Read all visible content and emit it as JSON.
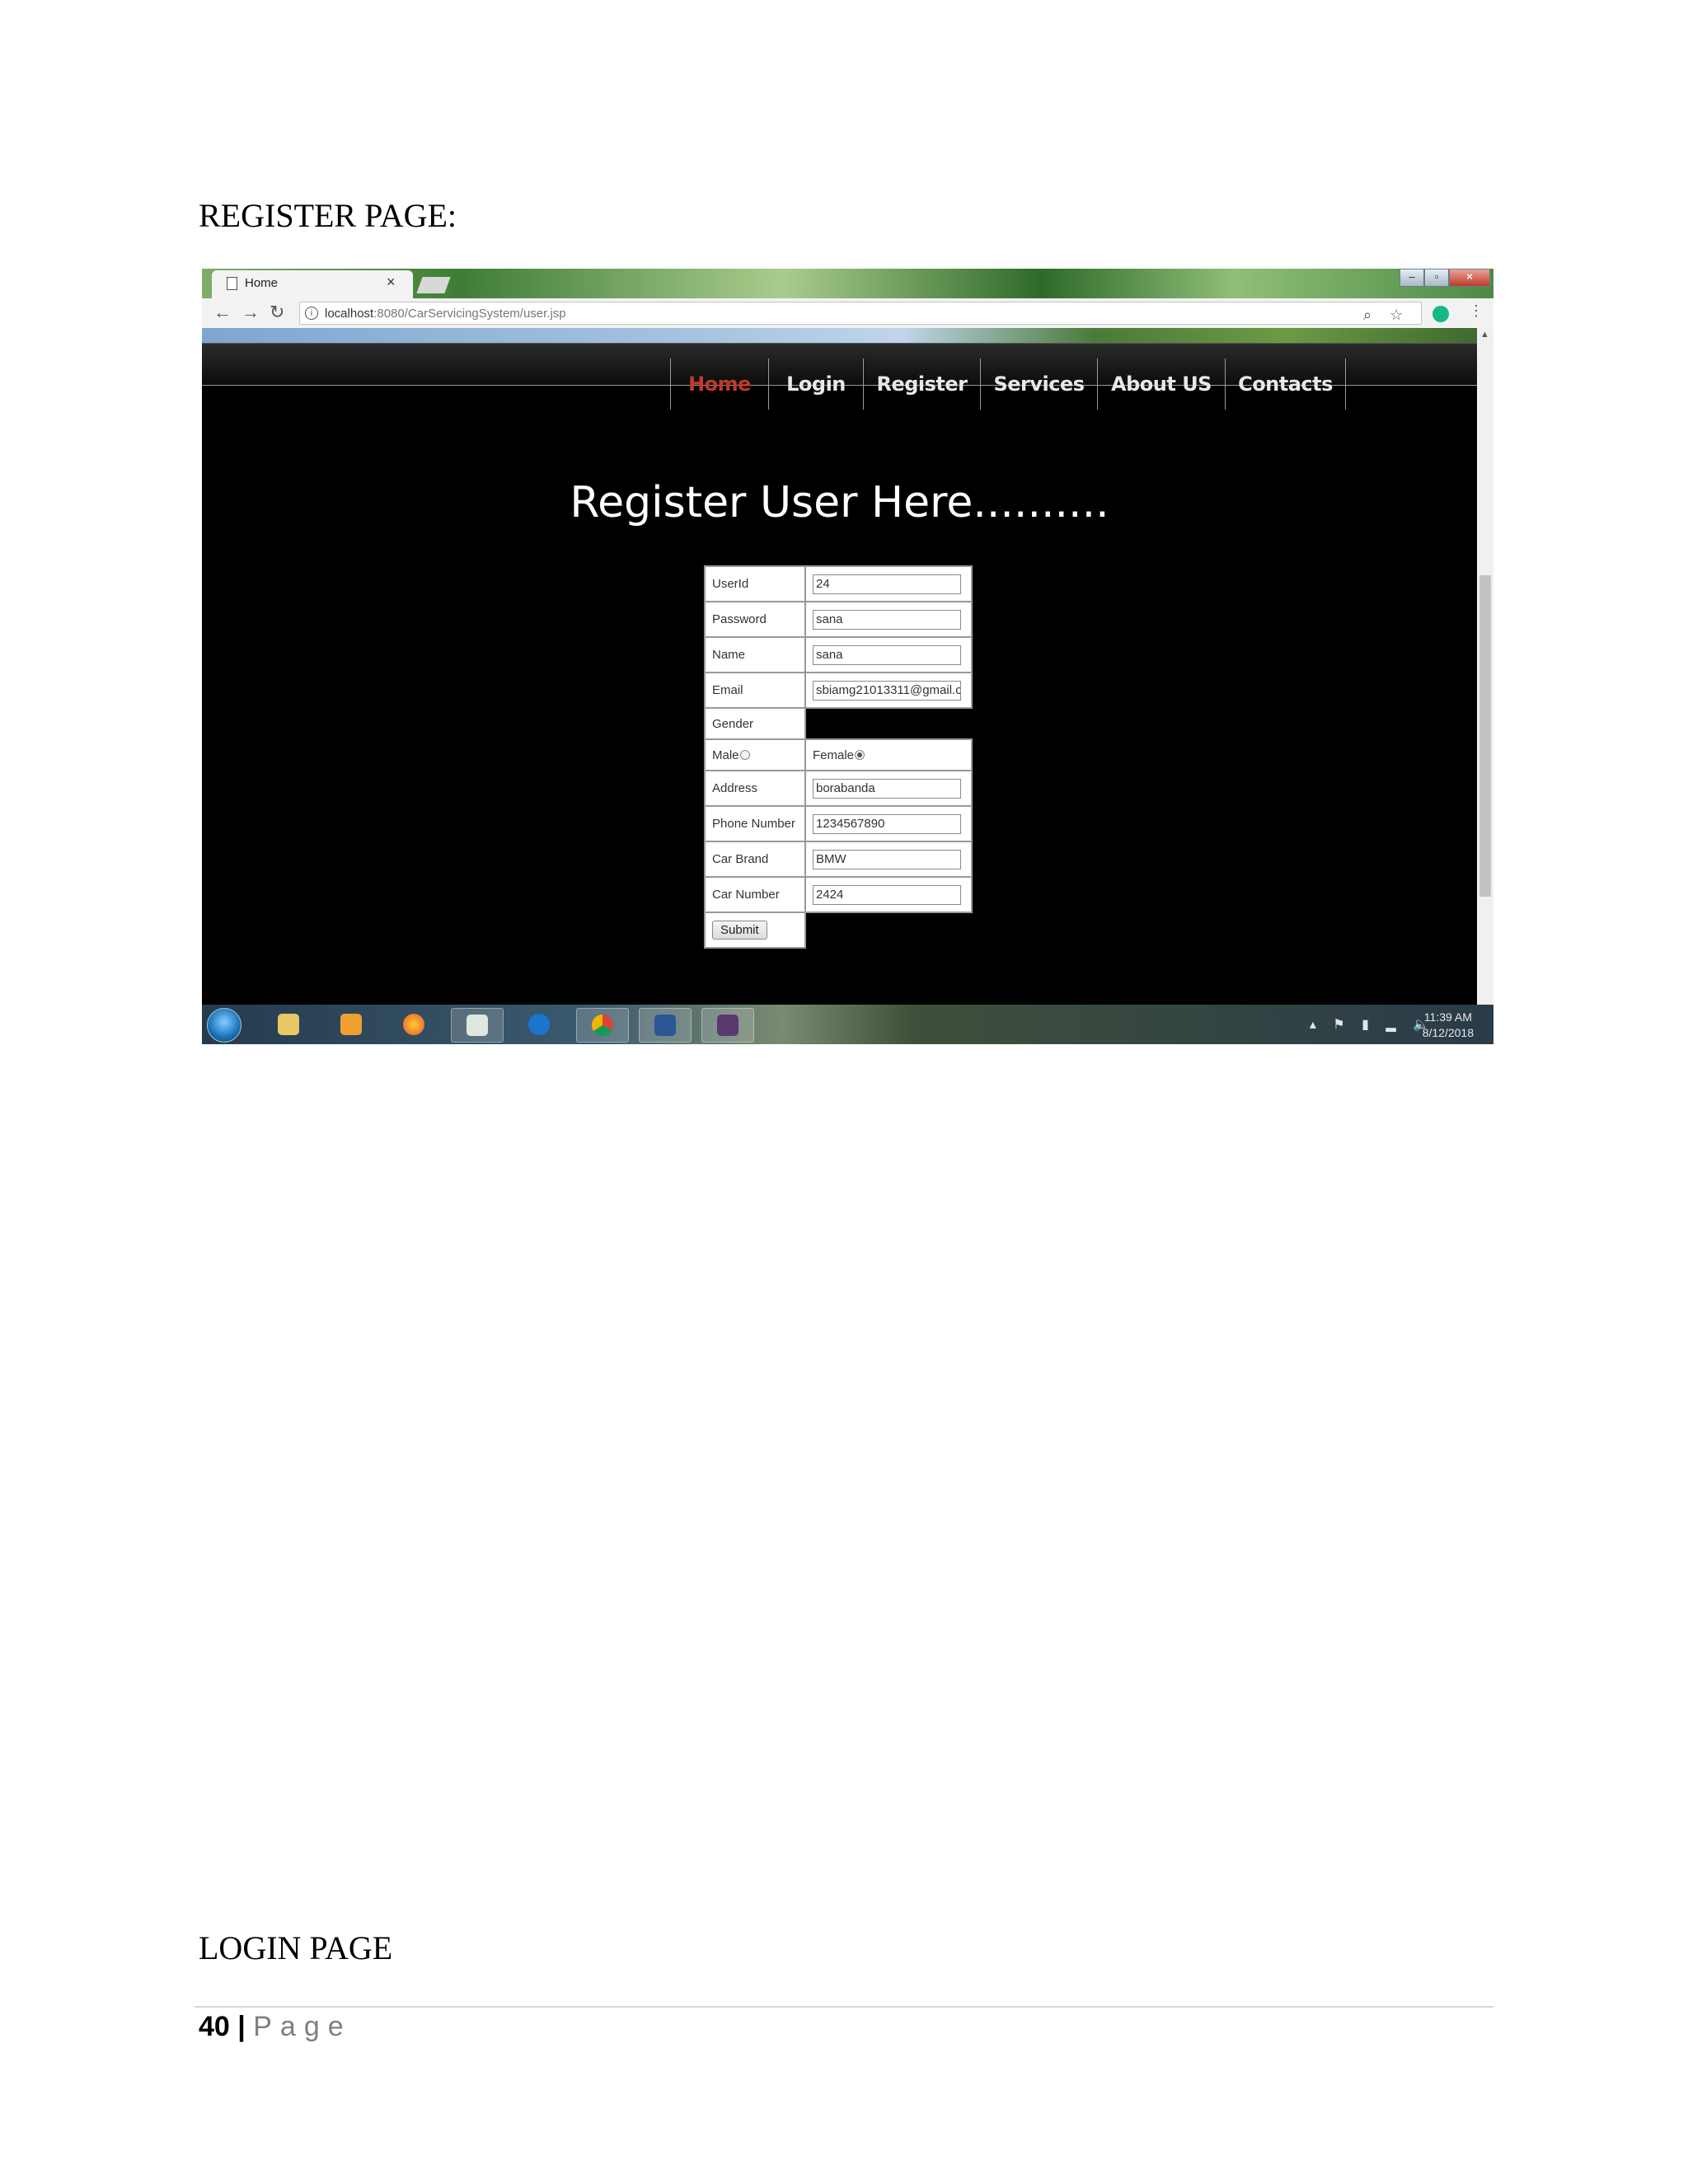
{
  "document": {
    "heading_register": "REGISTER PAGE:",
    "heading_login": "LOGIN PAGE",
    "footer_page_number": "40",
    "footer_separator": "|",
    "footer_page_word": "Page"
  },
  "browser": {
    "tab_title": "Home",
    "tab_close": "×",
    "url_host": "localhost",
    "url_rest": ":8080/CarServicingSystem/user.jsp",
    "window_controls": [
      "–",
      "▫",
      "×"
    ]
  },
  "site": {
    "nav": [
      {
        "label": "Home",
        "active": true
      },
      {
        "label": "Login"
      },
      {
        "label": "Register"
      },
      {
        "label": "Services"
      },
      {
        "label": "About US"
      },
      {
        "label": "Contacts"
      }
    ],
    "heading": "Register User Here..........",
    "form": {
      "userid_label": "UserId",
      "userid_value": "24",
      "password_label": "Password",
      "password_value": "sana",
      "name_label": "Name",
      "name_value": "sana",
      "email_label": "Email",
      "email_value": "sbiamg21013311@gmail.c",
      "gender_label": "Gender",
      "male_label": "Male",
      "female_label": "Female",
      "gender_selected": "Female",
      "address_label": "Address",
      "address_value": "borabanda",
      "phone_label": "Phone Number",
      "phone_value": "1234567890",
      "car_brand_label": "Car Brand",
      "car_brand_value": "BMW",
      "car_number_label": "Car Number",
      "car_number_value": "2424",
      "submit_label": "Submit"
    }
  },
  "taskbar": {
    "apps": [
      "file-explorer-icon",
      "media-player-icon",
      "firefox-icon",
      "window-app-icon",
      "teamviewer-icon",
      "chrome-icon",
      "word-icon",
      "game-icon"
    ],
    "clock_time": "11:39 AM",
    "clock_date": "8/12/2018"
  },
  "colors": {
    "nav_active": "#c0392b",
    "page_background": "#000000"
  }
}
